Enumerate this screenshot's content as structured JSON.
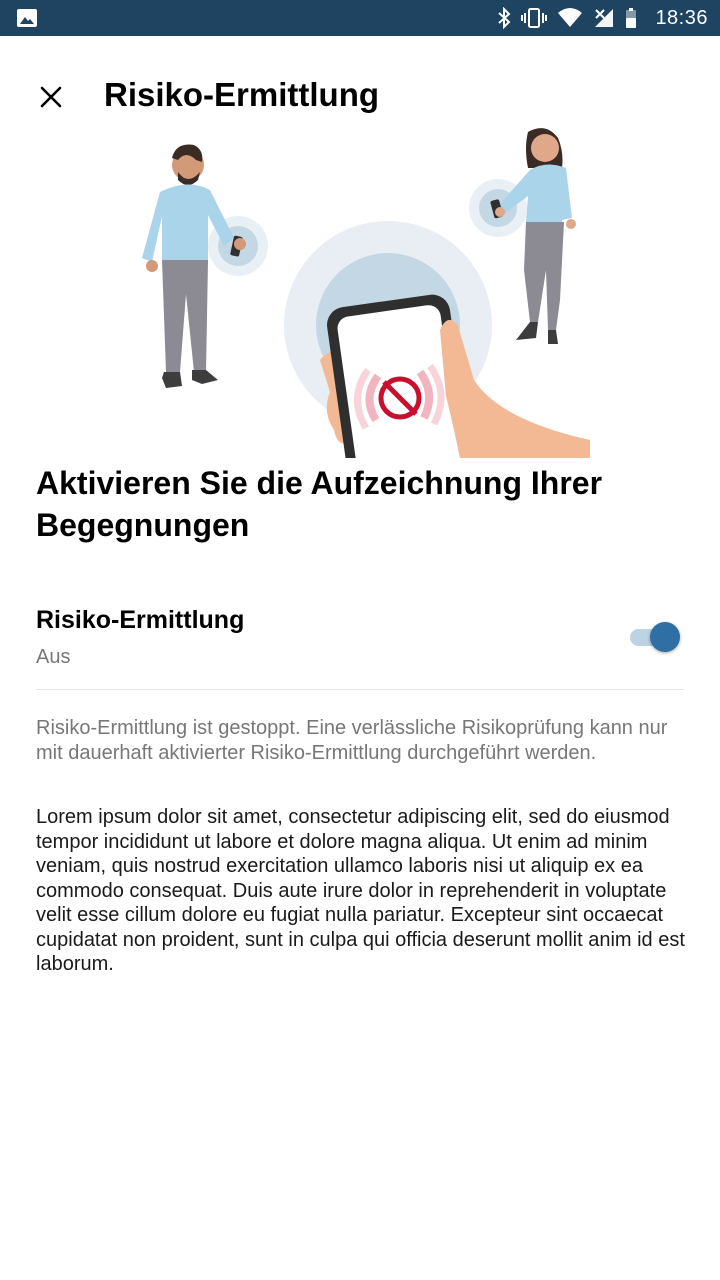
{
  "status_bar": {
    "time": "18:36",
    "icons": [
      "image-icon",
      "bluetooth-icon",
      "vibrate-icon",
      "wifi-icon",
      "signal-icon",
      "battery-icon"
    ],
    "background_color": "#1e4461"
  },
  "header": {
    "close_icon": "close-icon",
    "title": "Risiko-Ermittlung"
  },
  "illustration": {
    "icon": "tracing-disabled-icon",
    "accent_color": "#c8102e"
  },
  "main": {
    "headline": "Aktivieren Sie die Aufzeichnung Ihrer Begegnungen",
    "toggle": {
      "label": "Risiko-Ermittlung",
      "status": "Aus",
      "on": true,
      "accent_color": "#2f6fa3"
    },
    "info": "Risiko-Ermittlung ist gestoppt. Eine verlässliche Risikoprüfung kann nur mit dauerhaft aktivierter Risiko-Ermittlung durchgeführt werden.",
    "body": "Lorem ipsum dolor sit amet, consectetur adipiscing elit, sed do eiusmod tempor incididunt ut labore et dolore magna aliqua. Ut enim ad minim veniam, quis nostrud exercitation ullamco laboris nisi ut aliquip ex ea commodo consequat. Duis aute irure dolor in reprehenderit in voluptate velit esse cillum dolore eu fugiat nulla pariatur. Excepteur sint occaecat cupidatat non proident, sunt in culpa qui officia deserunt mollit anim id est laborum."
  }
}
